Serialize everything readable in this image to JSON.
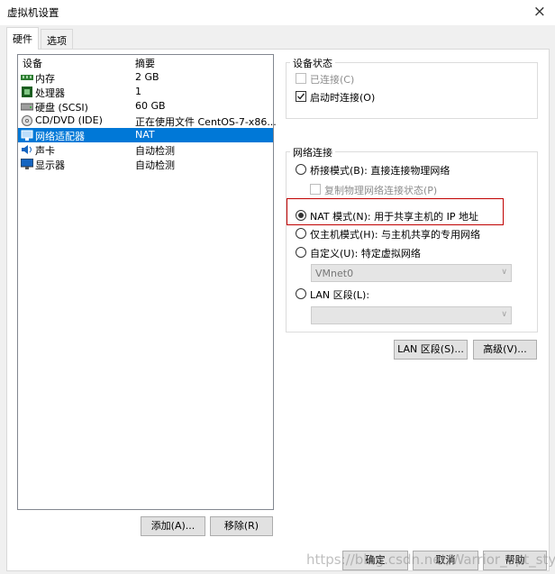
{
  "window": {
    "title": "虚拟机设置",
    "close": "×"
  },
  "tabs": [
    {
      "label": "硬件"
    },
    {
      "label": "选项"
    }
  ],
  "device_list": {
    "header_device": "设备",
    "header_summary": "摘要",
    "rows": [
      {
        "name": "内存",
        "summary": "2 GB",
        "icon": "memory-icon"
      },
      {
        "name": "处理器",
        "summary": "1",
        "icon": "processor-icon"
      },
      {
        "name": "硬盘 (SCSI)",
        "summary": "60 GB",
        "icon": "hard-disk-icon"
      },
      {
        "name": "CD/DVD (IDE)",
        "summary": "正在使用文件 CentOS-7-x86...",
        "icon": "cd-dvd-icon"
      },
      {
        "name": "网络适配器",
        "summary": "NAT",
        "icon": "network-adapter-icon"
      },
      {
        "name": "声卡",
        "summary": "自动检测",
        "icon": "sound-card-icon"
      },
      {
        "name": "显示器",
        "summary": "自动检测",
        "icon": "display-icon"
      }
    ],
    "selected_index": 4
  },
  "list_buttons": {
    "add": "添加(A)...",
    "remove": "移除(R)"
  },
  "device_status": {
    "title": "设备状态",
    "connected": {
      "label": "已连接(C)",
      "checked": false,
      "enabled": false
    },
    "connect_at_power_on": {
      "label": "启动时连接(O)",
      "checked": true,
      "enabled": true
    }
  },
  "network_connection": {
    "title": "网络连接",
    "bridged": "桥接模式(B): 直接连接物理网络",
    "replicate": "复制物理网络连接状态(P)",
    "nat": "NAT 模式(N): 用于共享主机的 IP 地址",
    "host_only": "仅主机模式(H): 与主机共享的专用网络",
    "custom": "自定义(U): 特定虚拟网络",
    "custom_value": "VMnet0",
    "lan_segment": "LAN 区段(L):",
    "lan_value": "",
    "selected": "nat"
  },
  "network_buttons": {
    "lan_segments": "LAN 区段(S)...",
    "advanced": "高级(V)..."
  },
  "dialog_buttons": {
    "ok": "确定",
    "cancel": "取消",
    "help": "帮助"
  },
  "watermark": "https://blog.csdn.net/Warrior_opt_style",
  "colors": {
    "selection": "#0078d7",
    "highlight": "#c00000",
    "dialog_bg": "#f0f0f0"
  }
}
